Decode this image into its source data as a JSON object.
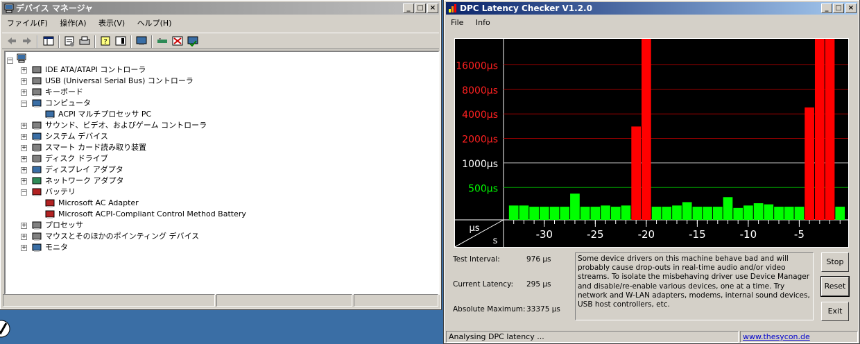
{
  "device_manager": {
    "title": "デバイス マネージャ",
    "menu": [
      "ファイル(F)",
      "操作(A)",
      "表示(V)",
      "ヘルプ(H)"
    ],
    "tree": [
      {
        "label": "IDE ATA/ATAPI コントローラ",
        "icon": "ide-controller-icon"
      },
      {
        "label": "USB (Universal Serial Bus) コントローラ",
        "icon": "usb-icon"
      },
      {
        "label": "キーボード",
        "icon": "keyboard-icon"
      },
      {
        "label": "コンピュータ",
        "icon": "computer-icon"
      },
      {
        "label": "ACPI マルチプロセッサ PC",
        "icon": "computer-icon"
      },
      {
        "label": "サウンド、ビデオ、およびゲーム コントローラ",
        "icon": "speaker-icon"
      },
      {
        "label": "システム デバイス",
        "icon": "system-device-icon"
      },
      {
        "label": "スマート カード読み取り装置",
        "icon": "smart-card-icon"
      },
      {
        "label": "ディスク ドライブ",
        "icon": "disk-drive-icon"
      },
      {
        "label": "ディスプレイ アダプタ",
        "icon": "display-adapter-icon"
      },
      {
        "label": "ネットワーク アダプタ",
        "icon": "network-adapter-icon"
      },
      {
        "label": "バッテリ",
        "icon": "battery-icon"
      },
      {
        "label": "Microsoft AC Adapter",
        "icon": "battery-icon"
      },
      {
        "label": "Microsoft ACPI-Compliant Control Method Battery",
        "icon": "battery-icon"
      },
      {
        "label": "プロセッサ",
        "icon": "processor-icon"
      },
      {
        "label": "マウスとそのほかのポインティング デバイス",
        "icon": "mouse-icon"
      },
      {
        "label": "モニタ",
        "icon": "monitor-icon"
      }
    ]
  },
  "dpc": {
    "title": "DPC Latency Checker V1.2.0",
    "menu": [
      "File",
      "Info"
    ],
    "test_interval_label": "Test Interval:",
    "test_interval_value": "976 µs",
    "current_latency_label": "Current Latency:",
    "current_latency_value": "295 µs",
    "absolute_max_label": "Absolute Maximum:",
    "absolute_max_value": "33375 µs",
    "info_text": "Some device drivers on this machine behave bad and will probably cause drop-outs in real-time audio and/or video streams. To isolate the misbehaving driver use Device Manager and disable/re-enable various devices, one at a time. Try network and W-LAN adapters, modems, internal sound devices, USB host controllers, etc.",
    "buttons": {
      "stop": "Stop",
      "reset": "Reset",
      "exit": "Exit"
    },
    "status": "Analysing DPC latency ...",
    "url": "www.thesycon.de"
  },
  "chart_data": {
    "type": "bar",
    "corner_y_unit": "µs",
    "corner_x_unit": "s",
    "y_scale": "log",
    "y_ticks": [
      {
        "label": "16000µs",
        "value": 16000,
        "color": "#ff2020"
      },
      {
        "label": "8000µs",
        "value": 8000,
        "color": "#ff2020"
      },
      {
        "label": "4000µs",
        "value": 4000,
        "color": "#ff2020"
      },
      {
        "label": "2000µs",
        "value": 2000,
        "color": "#ff2020"
      },
      {
        "label": "1000µs",
        "value": 1000,
        "color": "#ffffff"
      },
      {
        "label": "500µs",
        "value": 500,
        "color": "#00ff00"
      }
    ],
    "x_ticks": [
      -30,
      -25,
      -20,
      -15,
      -10,
      -5
    ],
    "x": [
      -33,
      -32,
      -31,
      -30,
      -29,
      -28,
      -27,
      -26,
      -25,
      -24,
      -23,
      -22,
      -21,
      -20,
      -19,
      -18,
      -17,
      -16,
      -15,
      -14,
      -13,
      -12,
      -11,
      -10,
      -9,
      -8,
      -7,
      -6,
      -5,
      -4,
      -3,
      -2,
      -1
    ],
    "values": [
      300,
      300,
      290,
      290,
      290,
      290,
      420,
      290,
      290,
      300,
      290,
      300,
      2800,
      33375,
      290,
      290,
      300,
      330,
      290,
      290,
      290,
      380,
      280,
      300,
      320,
      310,
      290,
      290,
      290,
      4800,
      33375,
      33375,
      290
    ],
    "colors": {
      "ok": "#00ff00",
      "bad": "#ff0000",
      "threshold": 1000
    },
    "ylim": [
      200,
      33375
    ],
    "xlim": [
      -34,
      -0.2
    ]
  }
}
